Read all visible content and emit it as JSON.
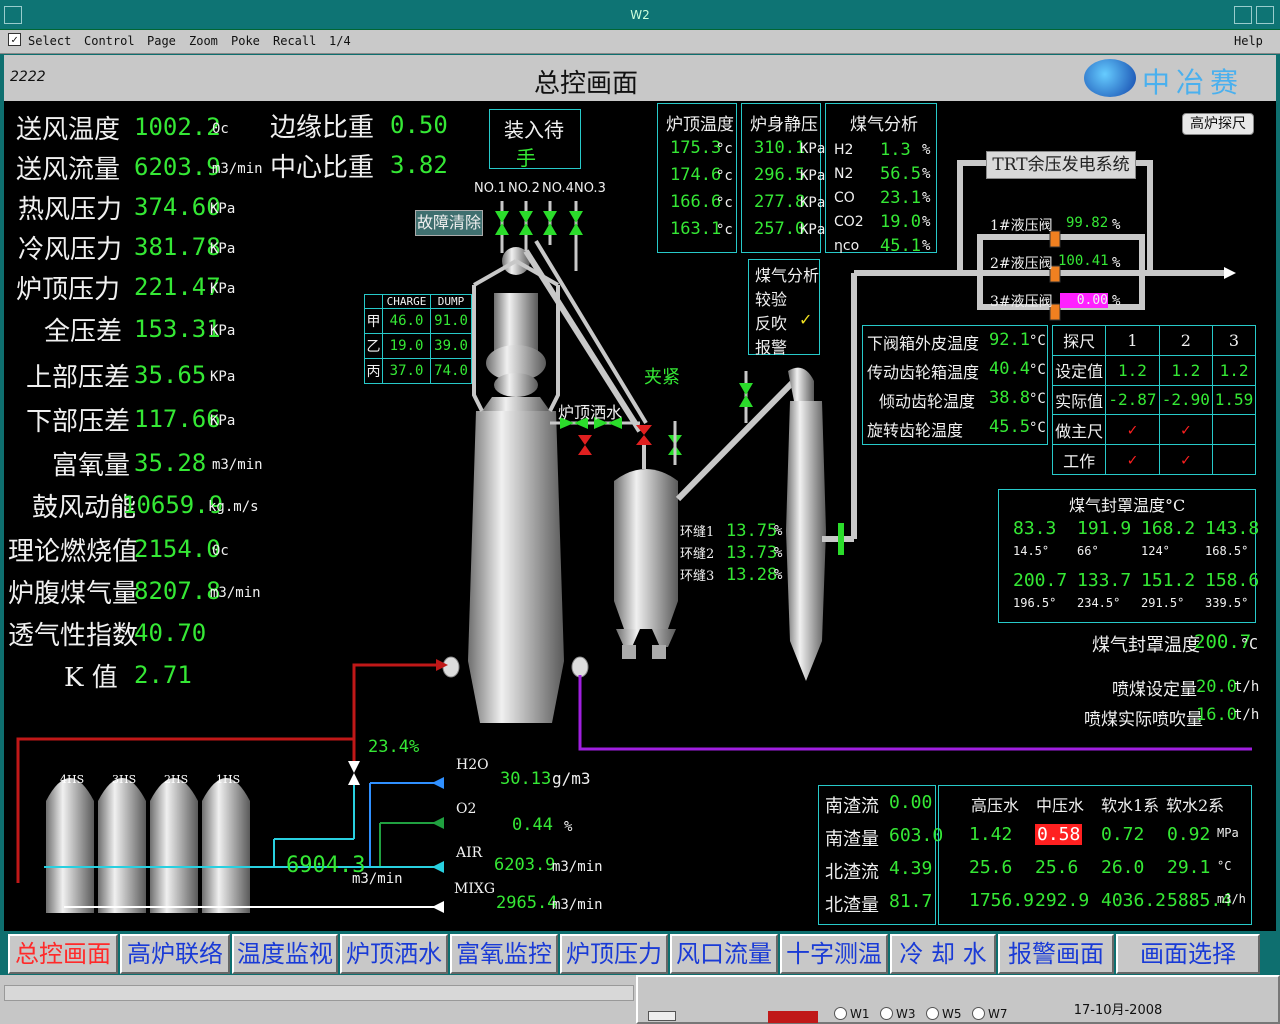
{
  "window": {
    "title": "W2"
  },
  "menu": {
    "select": "Select",
    "items": [
      "Control",
      "Page",
      "Zoom",
      "Poke",
      "Recall",
      "1/4"
    ],
    "help": "Help"
  },
  "header": {
    "id": "2222",
    "title": "总控画面",
    "logo": "中冶赛迪"
  },
  "left_params": [
    {
      "label": "送风温度",
      "value": "1002.2",
      "unit": "0c"
    },
    {
      "label": "送风流量",
      "value": "6203.9",
      "unit": "m3/min"
    },
    {
      "label": "热风压力",
      "value": "374.60",
      "unit": "KPa"
    },
    {
      "label": "冷风压力",
      "value": "381.78",
      "unit": "KPa"
    },
    {
      "label": "炉顶压力",
      "value": "221.47",
      "unit": "KPa"
    },
    {
      "label": "全压差",
      "value": "153.31",
      "unit": "KPa"
    },
    {
      "label": "上部压差",
      "value": "35.65",
      "unit": "KPa"
    },
    {
      "label": "下部压差",
      "value": "117.66",
      "unit": "KPa"
    },
    {
      "label": "富氧量",
      "value": "35.28",
      "unit": "m3/min"
    },
    {
      "label": "鼓风动能",
      "value": "10659.9",
      "unit": "kg.m/s"
    },
    {
      "label": "理论燃烧值",
      "value": "2154.0",
      "unit": "0c"
    },
    {
      "label": "炉腹煤气量",
      "value": "8207.8",
      "unit": "m3/min"
    },
    {
      "label": "透气性指数",
      "value": "40.70",
      "unit": ""
    },
    {
      "label": "K 值",
      "value": "2.71",
      "unit": ""
    }
  ],
  "ratios": [
    {
      "label": "边缘比重",
      "value": "0.50"
    },
    {
      "label": "中心比重",
      "value": "3.82"
    }
  ],
  "charge_mode": {
    "title": "装入待",
    "value": "手"
  },
  "valves": [
    "NO.1",
    "NO.2",
    "NO.4",
    "NO.3"
  ],
  "fault_clear": "故障清除",
  "charge_table": {
    "headers": [
      "CHARGE",
      "DUMP"
    ],
    "rows": [
      [
        "甲",
        "46.0",
        "91.0"
      ],
      [
        "乙",
        "19.0",
        "39.0"
      ],
      [
        "丙",
        "37.0",
        "74.0"
      ]
    ]
  },
  "top_temp": {
    "title": "炉顶温度",
    "values": [
      "175.3",
      "174.6",
      "166.6",
      "163.1"
    ],
    "unit": "°c"
  },
  "body_press": {
    "title": "炉身静压",
    "values": [
      "310.1",
      "296.5",
      "277.8",
      "257.0"
    ],
    "unit": "KPa"
  },
  "gas_analysis": {
    "title": "煤气分析",
    "rows": [
      [
        "H2",
        "1.3",
        "%"
      ],
      [
        "N2",
        "56.5",
        "%"
      ],
      [
        "CO",
        "23.1",
        "%"
      ],
      [
        "CO2",
        "19.0",
        "%"
      ],
      [
        "ηco",
        "45.1",
        "%"
      ]
    ]
  },
  "gas_check": {
    "title": "煤气分析",
    "items": [
      "较验",
      "反吹",
      "报警"
    ],
    "check": "✓"
  },
  "trt": {
    "title": "TRT余压发电系统",
    "valves": [
      {
        "label": "1#液压阀",
        "value": "99.82",
        "unit": "%"
      },
      {
        "label": "2#液压阀",
        "value": "100.41",
        "unit": "%"
      },
      {
        "label": "3#液压阀",
        "value": "0.00",
        "unit": "%"
      }
    ]
  },
  "gear_temps": [
    {
      "label": "下阀箱外皮温度",
      "value": "92.1",
      "unit": "°C"
    },
    {
      "label": "传动齿轮箱温度",
      "value": "40.4",
      "unit": "°C"
    },
    {
      "label": "倾动齿轮温度",
      "value": "38.8",
      "unit": "°C"
    },
    {
      "label": "旋转齿轮温度",
      "value": "45.5",
      "unit": "°C"
    }
  ],
  "probe": {
    "button": "高炉探尺",
    "headers": [
      "探尺",
      "1",
      "2",
      "3"
    ],
    "rows": [
      [
        "设定值",
        "1.2",
        "1.2",
        "1.2"
      ],
      [
        "实际值",
        "-2.87",
        "-2.90",
        "1.59"
      ],
      [
        "做主尺",
        "✓",
        "✓",
        ""
      ],
      [
        "工作",
        "✓",
        "✓",
        ""
      ]
    ]
  },
  "labels": {
    "clamp": "夹紧",
    "top_spray": "炉顶洒水",
    "ring1": "环缝1",
    "ring2": "环缝2",
    "ring3": "环缝3",
    "ring_vals": [
      "13.75",
      "13.73",
      "13.28"
    ],
    "ring_unit": "%"
  },
  "seal_temp": {
    "title": "煤气封罩温度°C",
    "row1": [
      "83.3",
      "191.9",
      "168.2",
      "143.8"
    ],
    "row1b": [
      "14.5°",
      "66°",
      "124°",
      "168.5°"
    ],
    "row2": [
      "200.7",
      "133.7",
      "151.2",
      "158.6"
    ],
    "row2b": [
      "196.5°",
      "234.5°",
      "291.5°",
      "339.5°"
    ]
  },
  "seal_total": {
    "label": "煤气封罩温度",
    "value": "200.7",
    "unit": "°C"
  },
  "coal": [
    {
      "label": "喷煤设定量",
      "value": "20.0",
      "unit": "t/h"
    },
    {
      "label": "喷煤实际喷吹量",
      "value": "16.0",
      "unit": "t/h"
    }
  ],
  "stoves": [
    "4HS",
    "3HS",
    "2HS",
    "1HS"
  ],
  "blast": {
    "pct": "23.4%",
    "h2o": "H2O",
    "h2o_val": "30.13",
    "h2o_unit": "g/m3",
    "o2": "O2",
    "o2_val": "0.44",
    "o2_unit": "%",
    "air": "AIR",
    "air_val": "6203.9",
    "air_unit": "m3/min",
    "mixg": "MIXG",
    "mixg_val": "2965.4",
    "mixg_unit": "m3/min",
    "flow": "6904.3",
    "flow_unit": "m3/min"
  },
  "slag": [
    {
      "label": "南渣流",
      "value": "0.00"
    },
    {
      "label": "南渣量",
      "value": "603.0"
    },
    {
      "label": "北渣流",
      "value": "4.39"
    },
    {
      "label": "北渣量",
      "value": "81.7"
    }
  ],
  "water": {
    "headers": [
      "高压水",
      "中压水",
      "软水1系",
      "软水2系"
    ],
    "rows": [
      {
        "vals": [
          "1.42",
          "0.58",
          "0.72",
          "0.92"
        ],
        "unit": "MPa"
      },
      {
        "vals": [
          "25.6",
          "25.6",
          "26.0",
          "29.1"
        ],
        "unit": "°C"
      },
      {
        "vals": [
          "1756.9",
          "292.9",
          "4036.2",
          "5885.4"
        ],
        "unit": "m3/h"
      }
    ]
  },
  "tabs": [
    "总控画面",
    "高炉联络",
    "温度监视",
    "炉顶洒水",
    "富氧监控",
    "炉顶压力",
    "风口流量",
    "十字测温",
    "冷 却 水",
    "报警画面",
    "画面选择"
  ],
  "taskbar": {
    "radios": [
      "W1",
      "W3",
      "W5",
      "W7"
    ],
    "date": "17-10月-2008"
  }
}
